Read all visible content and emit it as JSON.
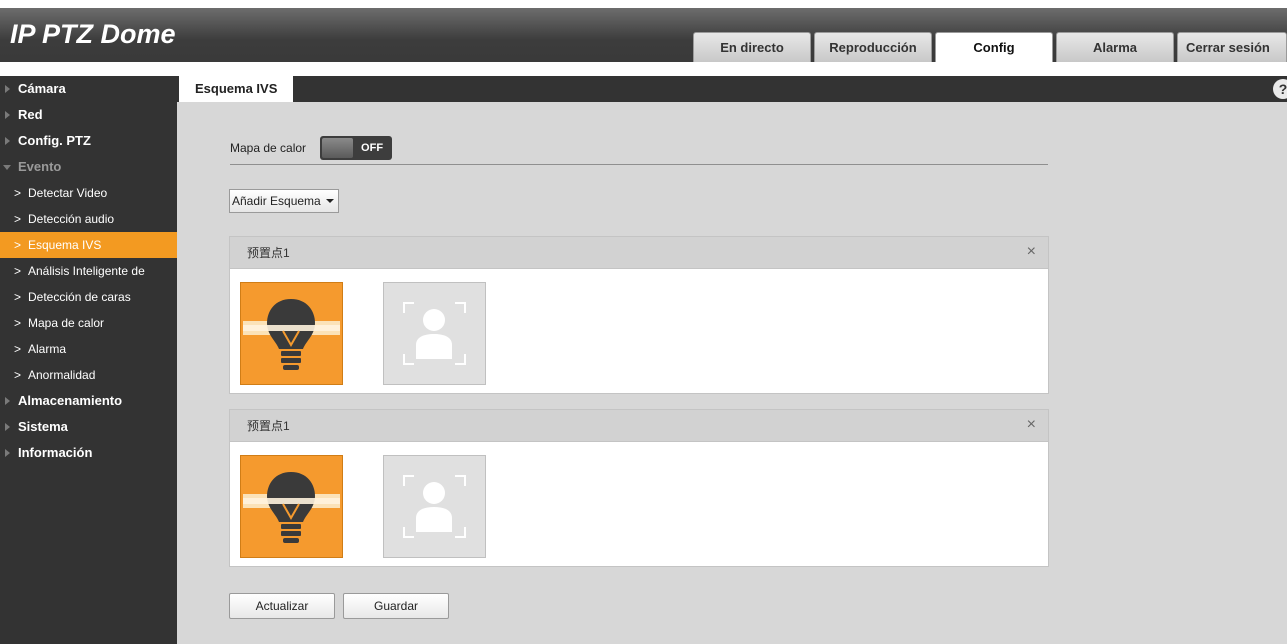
{
  "app": {
    "title": "IP PTZ Dome"
  },
  "topnav": {
    "tabs": [
      {
        "label": "En directo"
      },
      {
        "label": "Reproducción"
      },
      {
        "label": "Config",
        "active": true
      },
      {
        "label": "Alarma"
      },
      {
        "label": "Cerrar sesión"
      }
    ]
  },
  "sidebar": {
    "items": [
      {
        "label": "Cámara"
      },
      {
        "label": "Red"
      },
      {
        "label": "Config. PTZ"
      },
      {
        "label": "Evento",
        "expanded": true,
        "children": [
          {
            "label": "Detectar Video"
          },
          {
            "label": "Detección audio"
          },
          {
            "label": "Esquema IVS",
            "active": true
          },
          {
            "label": "Análisis Inteligente de"
          },
          {
            "label": "Detección de caras"
          },
          {
            "label": "Mapa de calor"
          },
          {
            "label": "Alarma"
          },
          {
            "label": "Anormalidad"
          }
        ]
      },
      {
        "label": "Almacenamiento"
      },
      {
        "label": "Sistema"
      },
      {
        "label": "Información"
      }
    ]
  },
  "content": {
    "tab_label": "Esquema IVS",
    "help_icon": "?",
    "heatmap": {
      "label": "Mapa de calor",
      "state": "OFF"
    },
    "add_scheme_label": "Añadir Esquema",
    "schemes": [
      {
        "title": "预置点1",
        "close": "×",
        "tiles": [
          "lightbulb-tripwire-icon",
          "face-detection-icon"
        ]
      },
      {
        "title": "预置点1",
        "close": "×",
        "tiles": [
          "lightbulb-tripwire-icon",
          "face-detection-icon"
        ]
      }
    ],
    "buttons": {
      "refresh": "Actualizar",
      "save": "Guardar"
    }
  },
  "colors": {
    "accent": "#f39a21",
    "sidebar_bg": "#333333",
    "content_bg": "#d7d7d7"
  }
}
